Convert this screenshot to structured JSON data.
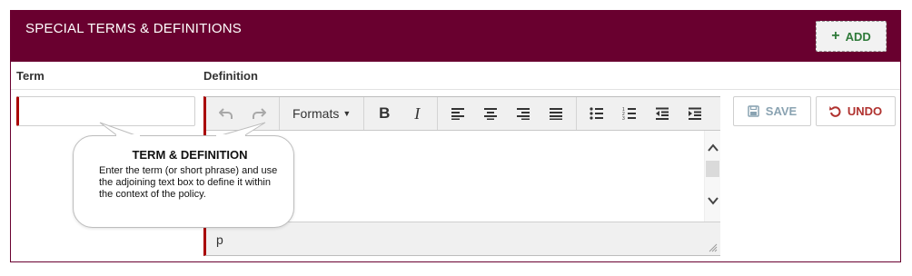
{
  "header": {
    "title": "SPECIAL TERMS & DEFINITIONS",
    "add_label": "ADD",
    "accent": "#69002f"
  },
  "columns": {
    "term": "Term",
    "definition": "Definition"
  },
  "term_input": {
    "value": "",
    "placeholder": ""
  },
  "editor": {
    "toolbar": {
      "undo_icon": "undo-icon",
      "redo_icon": "redo-icon",
      "formats_label": "Formats",
      "bold_icon": "bold-icon",
      "italic_icon": "italic-icon",
      "align_icons": [
        "align-left-icon",
        "align-center-icon",
        "align-right-icon",
        "align-justify-icon"
      ],
      "list_icons": [
        "bullet-list-icon",
        "numbered-list-icon",
        "outdent-icon",
        "indent-icon"
      ]
    },
    "content": "",
    "path": "p"
  },
  "actions": {
    "save_label": "SAVE",
    "undo_label": "UNDO",
    "save_color": "#8aa3b2",
    "undo_color": "#b0322f"
  },
  "tooltip": {
    "title": "TERM & DEFINITION",
    "body": "Enter the term (or short phrase) and use the adjoining text box to define it within the context of the policy."
  }
}
